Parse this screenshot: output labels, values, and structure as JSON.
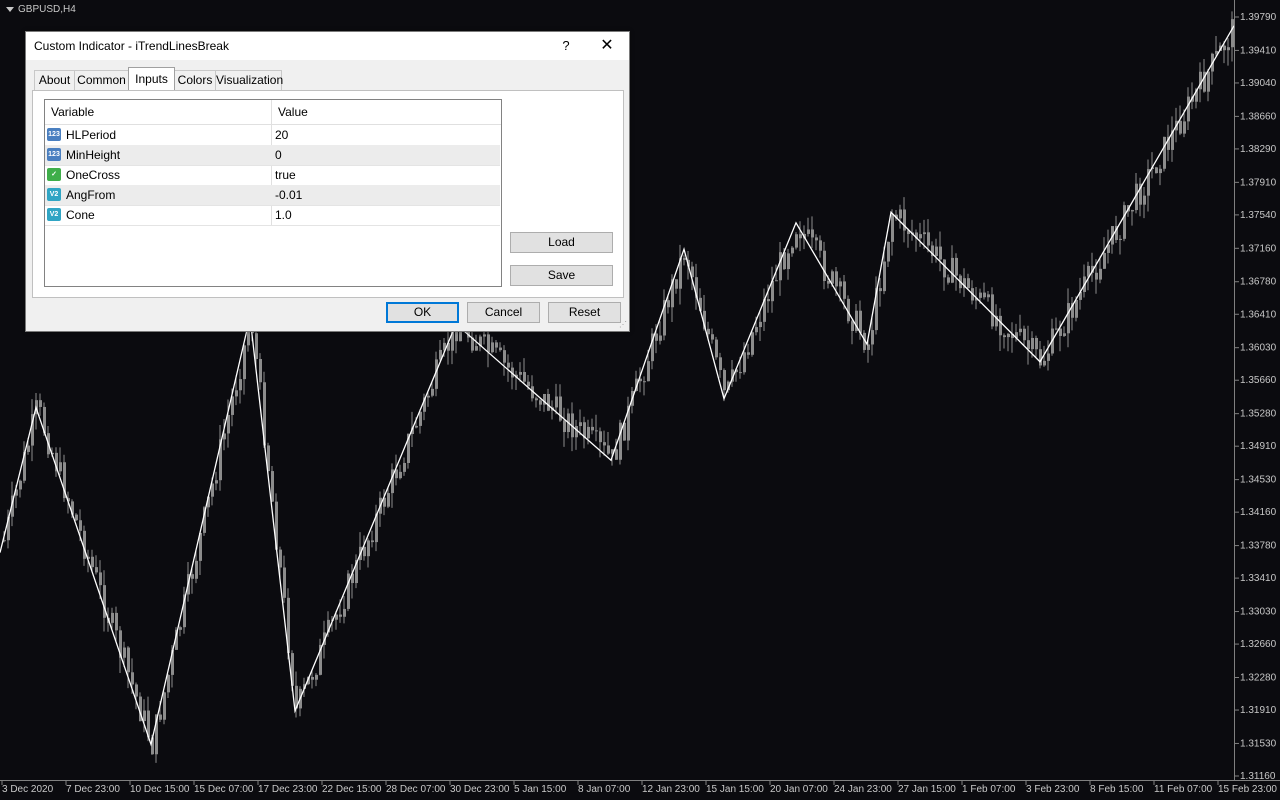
{
  "chart": {
    "symbol": "GBPUSD,H4",
    "y_ticks": [
      "1.39790",
      "1.39410",
      "1.39040",
      "1.38660",
      "1.38290",
      "1.37910",
      "1.37540",
      "1.37160",
      "1.36780",
      "1.36410",
      "1.36030",
      "1.35660",
      "1.35280",
      "1.34910",
      "1.34530",
      "1.34160",
      "1.33780",
      "1.33410",
      "1.33030",
      "1.32660",
      "1.32280",
      "1.31910",
      "1.31530",
      "1.31160"
    ],
    "x_ticks": [
      "3 Dec 2020",
      "7 Dec 23:00",
      "10 Dec 15:00",
      "15 Dec 07:00",
      "17 Dec 23:00",
      "22 Dec 15:00",
      "28 Dec 07:00",
      "30 Dec 23:00",
      "5 Jan 15:00",
      "8 Jan 07:00",
      "12 Jan 23:00",
      "15 Jan 15:00",
      "20 Jan 07:00",
      "24 Jan 23:00",
      "27 Jan 15:00",
      "1 Feb 07:00",
      "3 Feb 23:00",
      "8 Feb 15:00",
      "11 Feb 07:00",
      "15 Feb 23:00"
    ],
    "colors": {
      "background": "#0b0b0f",
      "candles": "#8c8c8c",
      "zigzag": "#ffffff",
      "axis_text": "#c8c8c8"
    },
    "zigzag_pivots": [
      1.337,
      1.3535,
      1.3152,
      1.3638,
      1.319,
      1.363,
      1.3475,
      1.3715,
      1.3545,
      1.3745,
      1.3607,
      1.3757,
      1.3587,
      1.3969
    ]
  },
  "dialog": {
    "title": "Custom Indicator - iTrendLinesBreak",
    "help": "?",
    "close": "✕",
    "tabs": [
      "About",
      "Common",
      "Inputs",
      "Colors",
      "Visualization"
    ],
    "active_tab": "Inputs",
    "grid": {
      "headers": {
        "variable": "Variable",
        "value": "Value"
      },
      "rows": [
        {
          "icon": "integer-icon",
          "icon_text": "123",
          "name": "HLPeriod",
          "value": "20"
        },
        {
          "icon": "integer-icon",
          "icon_text": "123",
          "name": "MinHeight",
          "value": "0"
        },
        {
          "icon": "boolean-icon",
          "icon_text": "✓",
          "name": "OneCross",
          "value": "true"
        },
        {
          "icon": "double-icon",
          "icon_text": "V2",
          "name": "AngFrom",
          "value": "-0.01"
        },
        {
          "icon": "double-icon",
          "icon_text": "V2",
          "name": "Cone",
          "value": "1.0"
        }
      ]
    },
    "buttons": {
      "load": "Load",
      "save": "Save",
      "ok": "OK",
      "cancel": "Cancel",
      "reset": "Reset"
    }
  }
}
